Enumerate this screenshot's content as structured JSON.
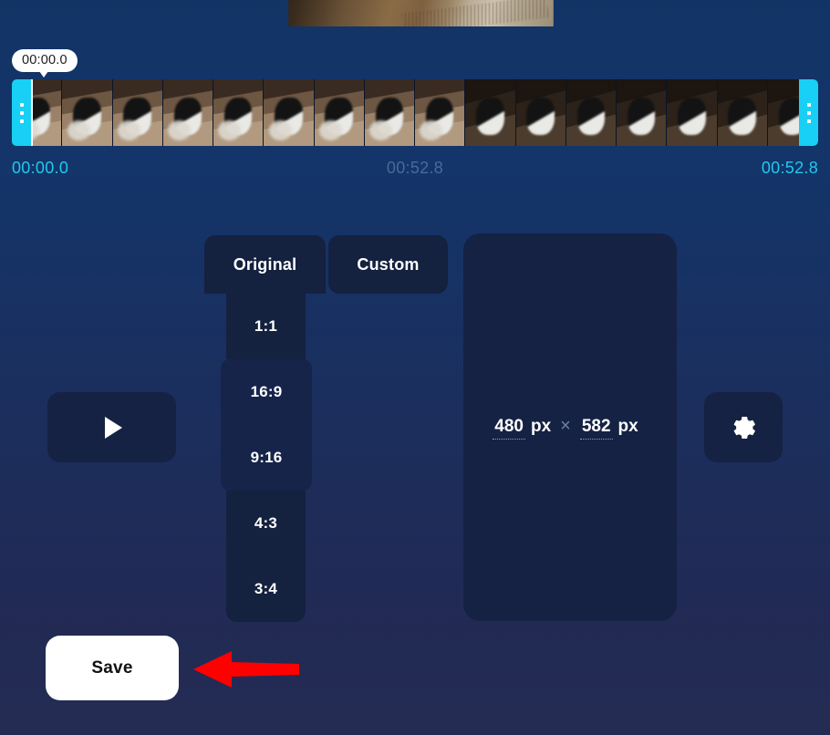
{
  "app": {
    "name": "video-resize-editor"
  },
  "preview": {
    "alt": "video-preview-frame"
  },
  "timeline": {
    "tooltip": "00:00.0",
    "start_label": "00:00.0",
    "middle_label": "00:52.8",
    "end_label": "00:52.8",
    "handle_left_name": "trim-handle-left",
    "handle_right_name": "trim-handle-right",
    "colors": {
      "handle": "#18d0f5",
      "label_active": "#22c8ec",
      "label_muted": "#4a6a96"
    },
    "frames": 16
  },
  "controls": {
    "play_label": "play-icon",
    "settings_label": "gear-icon"
  },
  "tabs": [
    {
      "id": "original",
      "label": "Original"
    },
    {
      "id": "custom",
      "label": "Custom"
    }
  ],
  "ratios": [
    {
      "id": "1-1",
      "label": "1:1"
    },
    {
      "id": "16-9",
      "label": "16:9"
    },
    {
      "id": "9-16",
      "label": "9:16"
    },
    {
      "id": "4-3",
      "label": "4:3"
    },
    {
      "id": "3-4",
      "label": "3:4"
    }
  ],
  "dimensions": {
    "width_value": "480",
    "width_unit": "px",
    "separator": "×",
    "height_value": "582",
    "height_unit": "px",
    "width_placeholder": "480",
    "height_placeholder": "582"
  },
  "actions": {
    "save_label": "Save"
  },
  "annotation": {
    "arrow_color": "#ff0000",
    "points_to": "save-button"
  },
  "theme": {
    "bg_top": "#123465",
    "bg_bottom": "#242c53",
    "panel": "#152243",
    "panel_alt": "#14213f",
    "accent_cyan": "#18d0f5",
    "text_primary": "#ffffff"
  }
}
